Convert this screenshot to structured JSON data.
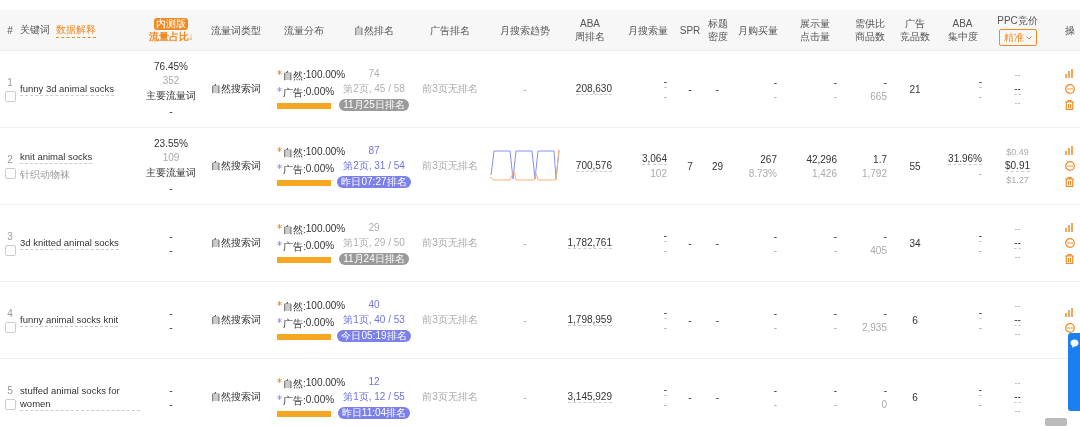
{
  "header": {
    "index": "#",
    "keyword": "关键词",
    "keyword_link": "数据解释",
    "share_badge": "内测版",
    "share": "流量占比↓",
    "columns": [
      [
        "流量词类型"
      ],
      [
        "流量分布"
      ],
      [
        "自然排名"
      ],
      [
        "广告排名"
      ],
      [
        "月搜索趋势"
      ],
      [
        "ABA",
        "周排名"
      ],
      [
        "月搜索量"
      ],
      [
        "SPR"
      ],
      [
        "标题",
        "密度"
      ],
      [
        "月购买量"
      ],
      [
        "展示量",
        "点击量"
      ],
      [
        "需供比",
        "商品数"
      ],
      [
        "广告",
        "竞品数"
      ],
      [
        "ABA",
        "集中度"
      ]
    ],
    "ppc": "PPC竞价",
    "ppc_filter": "精准",
    "actions": "操"
  },
  "rows": [
    {
      "index": "1",
      "checked": false,
      "keyword": "funny 3d animal socks",
      "share": [
        {
          "text": "76.45%",
          "kind": "main"
        },
        {
          "text": "352",
          "kind": "muted"
        },
        {
          "text": "主要流量词",
          "kind": "main"
        },
        {
          "text": "-",
          "kind": "main"
        }
      ],
      "type": "自然搜索词",
      "natural_label": "自然:",
      "natural": "100.00%",
      "ad_label": "广告:",
      "ad": "0.00%",
      "level": 1.0,
      "rank": "74",
      "rank_page": "第2页, 45 / 58",
      "rank_time": "11月25日排名",
      "rank_recent": false,
      "ad_rank": "前3页无排名",
      "trend": {
        "kind": "none",
        "text": "-"
      },
      "aba": "208,630",
      "search": [
        "-",
        "-"
      ],
      "spr": "-",
      "density": "-",
      "purchase": [
        "-",
        "-"
      ],
      "display": [
        "-",
        "-"
      ],
      "demand": [
        "-",
        "665"
      ],
      "competitors": "21",
      "concentration": [
        "-",
        "-"
      ],
      "ppc": [
        "--",
        "--",
        "--"
      ],
      "actions": [
        {
          "kind": "chart"
        },
        {
          "kind": "more"
        },
        {
          "kind": "delete"
        }
      ]
    },
    {
      "index": "2",
      "checked": false,
      "keyword": "knit animal socks",
      "translation": "针织动物袜",
      "share": [
        {
          "text": "23.55%",
          "kind": "main"
        },
        {
          "text": "109",
          "kind": "muted"
        },
        {
          "text": "主要流量词",
          "kind": "main"
        },
        {
          "text": "-",
          "kind": "main"
        }
      ],
      "type": "自然搜索词",
      "natural_label": "自然:",
      "natural": "100.00%",
      "ad_label": "广告:",
      "ad": "0.00%",
      "level": 1.0,
      "rank": "87",
      "rank_page": "第2页, 31 / 54",
      "rank_time": "昨日07:27排名",
      "rank_recent": true,
      "ad_rank": "前3页无排名",
      "trend": {
        "kind": "sparkline"
      },
      "aba": "700,576",
      "search": [
        "3,064",
        "102"
      ],
      "spr": "7",
      "density": "29",
      "purchase": [
        "267",
        "8.73%"
      ],
      "display": [
        "42,296",
        "1,426"
      ],
      "demand": [
        "1.7",
        "1,792"
      ],
      "competitors": "55",
      "concentration": [
        "31.96%",
        "-"
      ],
      "ppc": [
        "$0.49",
        "$0.91",
        "$1.27"
      ],
      "actions": [
        {
          "kind": "chart"
        },
        {
          "kind": "more"
        },
        {
          "kind": "delete"
        }
      ]
    },
    {
      "index": "3",
      "checked": false,
      "keyword": "3d knitted animal socks",
      "share": [
        {
          "text": "-",
          "kind": "main"
        },
        {
          "text": "-",
          "kind": "main"
        }
      ],
      "type": "自然搜索词",
      "natural_label": "自然:",
      "natural": "100.00%",
      "ad_label": "广告:",
      "ad": "0.00%",
      "level": 1.0,
      "rank": "29",
      "rank_page": "第1页, 29 / 50",
      "rank_time": "11月24日排名",
      "rank_recent": false,
      "ad_rank": "前3页无排名",
      "trend": {
        "kind": "none",
        "text": "-"
      },
      "aba": "1,782,761",
      "search": [
        "-",
        "-"
      ],
      "spr": "-",
      "density": "-",
      "purchase": [
        "-",
        "-"
      ],
      "display": [
        "-",
        "-"
      ],
      "demand": [
        "-",
        "405"
      ],
      "competitors": "34",
      "concentration": [
        "-",
        "-"
      ],
      "ppc": [
        "--",
        "--",
        "--"
      ],
      "actions": [
        {
          "kind": "chart"
        },
        {
          "kind": "more"
        },
        {
          "kind": "delete"
        }
      ]
    },
    {
      "index": "4",
      "checked": false,
      "keyword": "funny animal socks knit",
      "share": [
        {
          "text": "-",
          "kind": "main"
        },
        {
          "text": "-",
          "kind": "main"
        }
      ],
      "type": "自然搜索词",
      "natural_label": "自然:",
      "natural": "100.00%",
      "ad_label": "广告:",
      "ad": "0.00%",
      "level": 1.0,
      "rank": "40",
      "rank_page": "第1页, 40 / 53",
      "rank_time": "今日05:19排名",
      "rank_recent": true,
      "ad_rank": "前3页无排名",
      "trend": {
        "kind": "none",
        "text": "-"
      },
      "aba": "1,798,959",
      "search": [
        "-",
        "-"
      ],
      "spr": "-",
      "density": "-",
      "purchase": [
        "-",
        "-"
      ],
      "display": [
        "-",
        "-"
      ],
      "demand": [
        "-",
        "2,935"
      ],
      "competitors": "6",
      "concentration": [
        "-",
        "-"
      ],
      "ppc": [
        "--",
        "--",
        "--"
      ],
      "actions": [
        {
          "kind": "chart"
        },
        {
          "kind": "more"
        }
      ]
    },
    {
      "index": "5",
      "checked": false,
      "keyword": "stuffed animal socks for women",
      "share": [
        {
          "text": "-",
          "kind": "main"
        },
        {
          "text": "-",
          "kind": "main"
        }
      ],
      "type": "自然搜索词",
      "natural_label": "自然:",
      "natural": "100.00%",
      "ad_label": "广告:",
      "ad": "0.00%",
      "level": 1.0,
      "rank": "12",
      "rank_page": "第1页, 12 / 55",
      "rank_time": "昨日11:04排名",
      "rank_recent": true,
      "ad_rank": "前3页无排名",
      "trend": {
        "kind": "none",
        "text": "-"
      },
      "aba": "3,145,929",
      "search": [
        "-",
        "-"
      ],
      "spr": "-",
      "density": "-",
      "purchase": [
        "-",
        "-"
      ],
      "display": [
        "-",
        "-"
      ],
      "demand": [
        "-",
        "0"
      ],
      "competitors": "6",
      "concentration": [
        "-",
        "-"
      ],
      "ppc": [
        "--",
        "--",
        "--"
      ]
    }
  ]
}
